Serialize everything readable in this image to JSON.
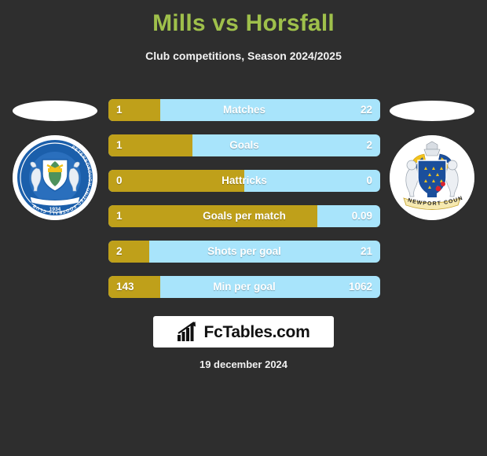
{
  "header": {
    "title": "Mills vs Horsfall",
    "subtitle": "Club competitions, Season 2024/2025",
    "title_color": "#9fc04b"
  },
  "teams": {
    "home": {
      "badge_name": "peterborough-united-football-club-badge",
      "badge_text_top": "PETERBOROUGH UNITED FOOTBALL CLUB",
      "badge_year": "1934"
    },
    "away": {
      "badge_name": "newport-county-badge",
      "badge_text_bottom": "NEWPORT COUNTY"
    }
  },
  "colors": {
    "background": "#2e2e2e",
    "home_bar": "#bfa01a",
    "away_bar": "#a8e4fb",
    "value_text": "#ffffff"
  },
  "chart_data": {
    "type": "bar",
    "title": "Mills vs Horsfall",
    "subtitle": "Club competitions, Season 2024/2025",
    "orientation": "horizontal-diverging",
    "series": [
      {
        "name": "Mills",
        "color": "#bfa01a",
        "values": [
          1,
          1,
          0,
          1,
          2,
          143
        ]
      },
      {
        "name": "Horsfall",
        "color": "#a8e4fb",
        "values": [
          22,
          2,
          0,
          0.09,
          21,
          1062
        ]
      }
    ],
    "categories": [
      "Matches",
      "Goals",
      "Hattricks",
      "Goals per match",
      "Shots per goal",
      "Min per goal"
    ],
    "rows": [
      {
        "label": "Matches",
        "home": "1",
        "away": "22",
        "home_pct": 19
      },
      {
        "label": "Goals",
        "home": "1",
        "away": "2",
        "home_pct": 31
      },
      {
        "label": "Hattricks",
        "home": "0",
        "away": "0",
        "home_pct": 50
      },
      {
        "label": "Goals per match",
        "home": "1",
        "away": "0.09",
        "home_pct": 77
      },
      {
        "label": "Shots per goal",
        "home": "2",
        "away": "21",
        "home_pct": 15
      },
      {
        "label": "Min per goal",
        "home": "143",
        "away": "1062",
        "home_pct": 19
      }
    ],
    "grid": false,
    "legend": "none"
  },
  "footer": {
    "logo_text": "FcTables.com",
    "logo_icon": "bar-chart-arrow-icon",
    "date": "19 december 2024"
  }
}
